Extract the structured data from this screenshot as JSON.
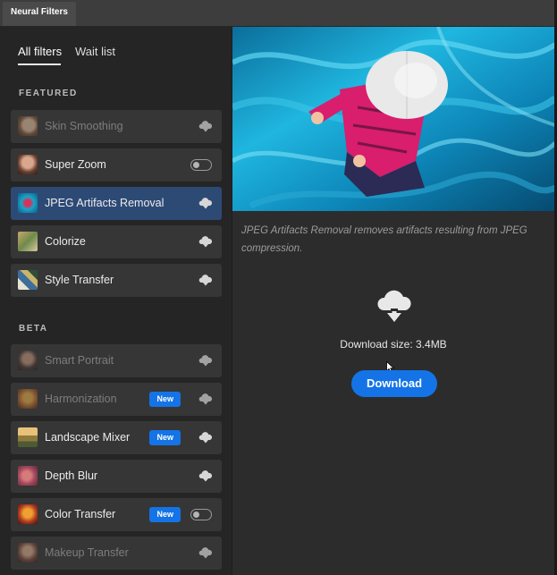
{
  "window": {
    "tab_title": "Neural Filters"
  },
  "sidebar": {
    "tabs": [
      {
        "label": "All filters",
        "active": true
      },
      {
        "label": "Wait list",
        "active": false
      }
    ],
    "sections": [
      {
        "label": "FEATURED",
        "items": [
          {
            "label": "Skin Smoothing",
            "state": "disabled",
            "control": "cloud-download-icon"
          },
          {
            "label": "Super Zoom",
            "state": "enabled",
            "control": "toggle-off"
          },
          {
            "label": "JPEG Artifacts Removal",
            "state": "selected",
            "control": "cloud-download-icon"
          },
          {
            "label": "Colorize",
            "state": "enabled",
            "control": "cloud-download-icon"
          },
          {
            "label": "Style Transfer",
            "state": "enabled",
            "control": "cloud-download-icon"
          }
        ]
      },
      {
        "label": "BETA",
        "items": [
          {
            "label": "Smart Portrait",
            "state": "disabled",
            "control": "cloud-download-icon"
          },
          {
            "label": "Harmonization",
            "state": "disabled",
            "badge": "New",
            "control": "cloud-download-icon"
          },
          {
            "label": "Landscape Mixer",
            "state": "enabled",
            "badge": "New",
            "control": "cloud-download-icon"
          },
          {
            "label": "Depth Blur",
            "state": "enabled",
            "control": "cloud-download-icon"
          },
          {
            "label": "Color Transfer",
            "state": "enabled",
            "badge": "New",
            "control": "toggle-off"
          },
          {
            "label": "Makeup Transfer",
            "state": "disabled",
            "control": "cloud-download-icon"
          }
        ]
      }
    ]
  },
  "main": {
    "description": "JPEG Artifacts Removal removes artifacts resulting from JPEG compression.",
    "download_size": "Download size: 3.4MB",
    "download_label": "Download"
  },
  "colors": {
    "accent": "#1473e6",
    "selected_row": "#2d4a75",
    "panel_bg": "#252525",
    "main_bg": "#2c2c2c"
  }
}
